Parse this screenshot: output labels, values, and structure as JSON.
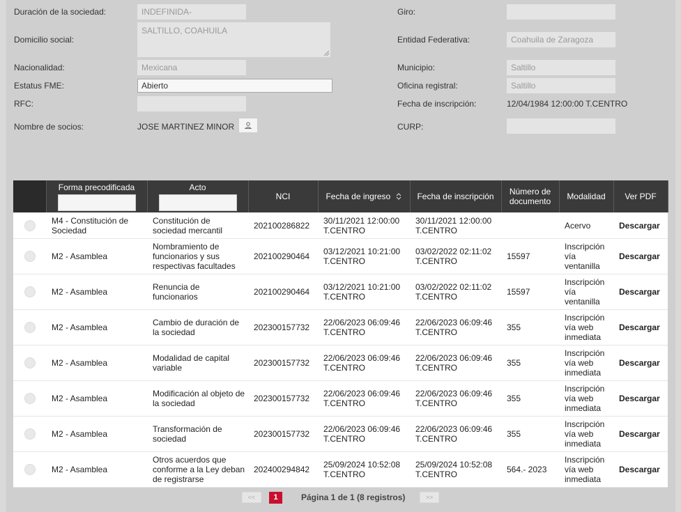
{
  "form": {
    "duracion": {
      "label": "Duración de la sociedad:",
      "value": "INDEFINIDA-"
    },
    "domicilio": {
      "label": "Domicilio social:",
      "value": "SALTILLO, COAHUILA"
    },
    "nacionalidad": {
      "label": "Nacionalidad:",
      "value": "Mexicana"
    },
    "estatus": {
      "label": "Estatus FME:",
      "value": "Abierto"
    },
    "rfc": {
      "label": "RFC:",
      "value": ""
    },
    "socios": {
      "label": "Nombre de socios:",
      "value": "JOSE MARTINEZ MINOR"
    },
    "giro": {
      "label": "Giro:",
      "value": ""
    },
    "entidad": {
      "label": "Entidad Federativa:",
      "value": "Coahuila de Zaragoza"
    },
    "municipio": {
      "label": "Municipio:",
      "value": "Saltillo"
    },
    "oficina": {
      "label": "Oficina registral:",
      "value": "Saltillo"
    },
    "fecha_inscripcion": {
      "label": "Fecha de inscripción:",
      "value": "12/04/1984 12:00:00 T.CENTRO"
    },
    "curp": {
      "label": "CURP:",
      "value": ""
    }
  },
  "table": {
    "headers": {
      "forma": "Forma precodificada",
      "acto": "Acto",
      "nci": "NCI",
      "fecha_ingreso": "Fecha de ingreso",
      "fecha_inscripcion": "Fecha de inscripción",
      "numero": "Número de documento",
      "modalidad": "Modalidad",
      "pdf": "Ver PDF"
    },
    "rows": [
      {
        "forma": "M4 - Constitución de Sociedad",
        "acto": "Constitución de sociedad mercantil",
        "nci": "202100286822",
        "ingreso": "30/11/2021 12:00:00 T.CENTRO",
        "inscripcion": "30/11/2021 12:00:00 T.CENTRO",
        "numero": "",
        "modalidad": "Acervo",
        "pdf": "Descargar"
      },
      {
        "forma": "M2 - Asamblea",
        "acto": "Nombramiento de funcionarios y sus respectivas facultades",
        "nci": "202100290464",
        "ingreso": "03/12/2021 10:21:00 T.CENTRO",
        "inscripcion": "03/02/2022 02:11:02 T.CENTRO",
        "numero": "15597",
        "modalidad": "Inscripción vía ventanilla",
        "pdf": "Descargar"
      },
      {
        "forma": "M2 - Asamblea",
        "acto": "Renuncia de funcionarios",
        "nci": "202100290464",
        "ingreso": "03/12/2021 10:21:00 T.CENTRO",
        "inscripcion": "03/02/2022 02:11:02 T.CENTRO",
        "numero": "15597",
        "modalidad": "Inscripción vía ventanilla",
        "pdf": "Descargar"
      },
      {
        "forma": "M2 - Asamblea",
        "acto": "Cambio de duración de la sociedad",
        "nci": "202300157732",
        "ingreso": "22/06/2023 06:09:46 T.CENTRO",
        "inscripcion": "22/06/2023 06:09:46 T.CENTRO",
        "numero": "355",
        "modalidad": "Inscripción vía web inmediata",
        "pdf": "Descargar"
      },
      {
        "forma": "M2 - Asamblea",
        "acto": "Modalidad de capital variable",
        "nci": "202300157732",
        "ingreso": "22/06/2023 06:09:46 T.CENTRO",
        "inscripcion": "22/06/2023 06:09:46 T.CENTRO",
        "numero": "355",
        "modalidad": "Inscripción vía web inmediata",
        "pdf": "Descargar"
      },
      {
        "forma": "M2 - Asamblea",
        "acto": "Modificación al objeto de la sociedad",
        "nci": "202300157732",
        "ingreso": "22/06/2023 06:09:46 T.CENTRO",
        "inscripcion": "22/06/2023 06:09:46 T.CENTRO",
        "numero": "355",
        "modalidad": "Inscripción vía web inmediata",
        "pdf": "Descargar"
      },
      {
        "forma": "M2 - Asamblea",
        "acto": "Transformación de sociedad",
        "nci": "202300157732",
        "ingreso": "22/06/2023 06:09:46 T.CENTRO",
        "inscripcion": "22/06/2023 06:09:46 T.CENTRO",
        "numero": "355",
        "modalidad": "Inscripción vía web inmediata",
        "pdf": "Descargar"
      },
      {
        "forma": "M2 - Asamblea",
        "acto": "Otros acuerdos que conforme a la Ley deban de registrarse",
        "nci": "202400294842",
        "ingreso": "25/09/2024 10:52:08 T.CENTRO",
        "inscripcion": "25/09/2024 10:52:08 T.CENTRO",
        "numero": "564.- 2023",
        "modalidad": "Inscripción vía web inmediata",
        "pdf": "Descargar"
      }
    ]
  },
  "pager": {
    "prev": "<<",
    "current": "1",
    "info": "Página 1 de 1 (8 registros)",
    "next": ">>"
  },
  "colors": {
    "header_bg": "#3a3a3a",
    "accent": "#c8102e",
    "panel": "#cfcfcf"
  }
}
